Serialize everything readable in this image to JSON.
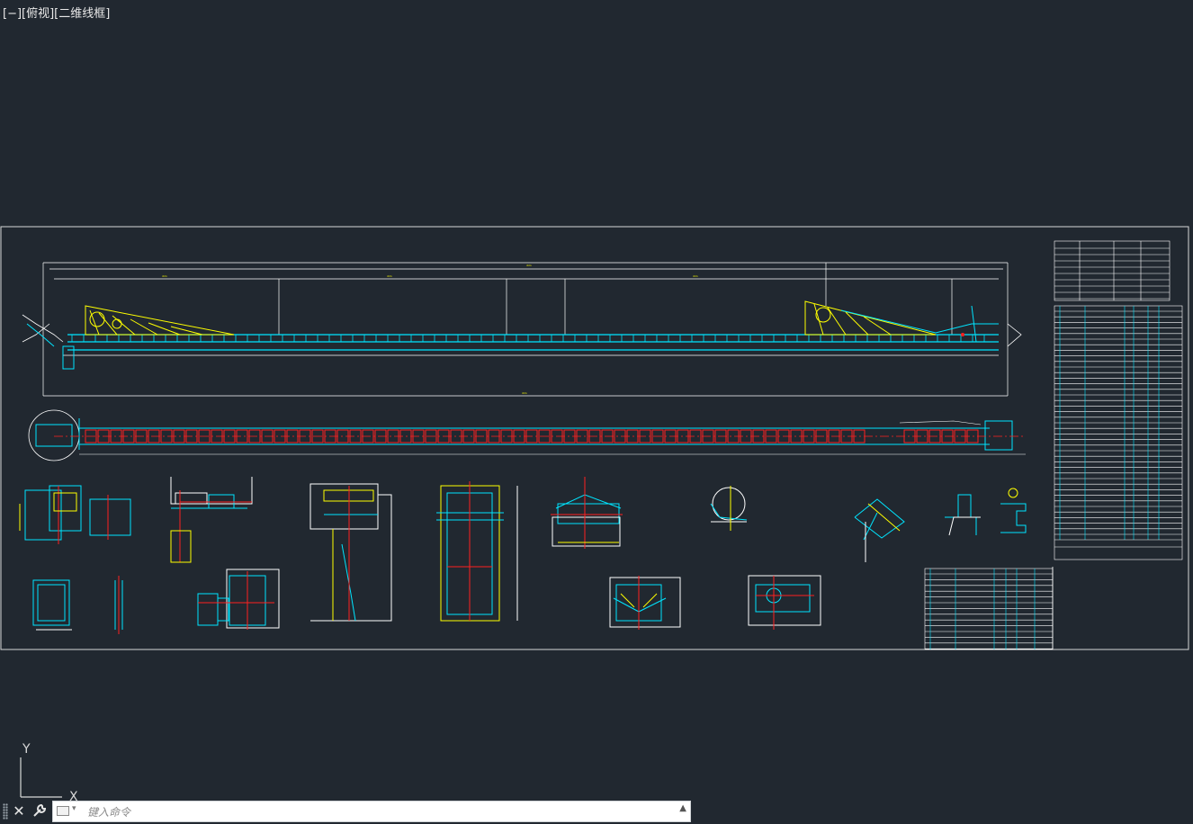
{
  "viewport": {
    "label": "[−][俯视][二维线框]"
  },
  "colors": {
    "background": "#212830",
    "frame": "#ffffff",
    "cyan": "#00e5ff",
    "yellow": "#ffff00",
    "red": "#ff2020",
    "green": "#00ff00",
    "magenta": "#ff00ff"
  },
  "ucs": {
    "y_label": "Y",
    "x_label": "X"
  },
  "command_line": {
    "placeholder": "键入命令",
    "close_icon": "close-icon",
    "customize_icon": "wrench-icon",
    "prompt_icon": "command-prompt-icon",
    "history_icon": "chevron-up-icon"
  }
}
